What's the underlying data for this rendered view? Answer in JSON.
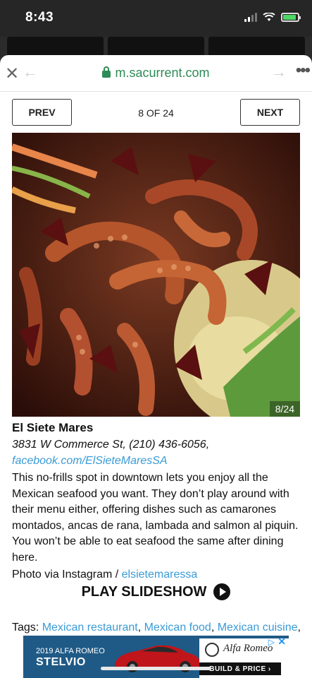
{
  "status": {
    "time": "8:43"
  },
  "browser": {
    "url": "m.sacurrent.com",
    "close_icon": "close-icon",
    "back_icon": "arrow-left-icon",
    "forward_icon": "arrow-right-icon",
    "more_icon": "more-icon"
  },
  "pager": {
    "prev_label": "PREV",
    "counter": "8 OF 24",
    "next_label": "NEXT"
  },
  "photo": {
    "badge": "8/24"
  },
  "article": {
    "title": "El Siete Mares",
    "address": "3831 W Commerce St, (210) 436-6056,",
    "facebook": "facebook.com/ElSieteMaresSA",
    "description": "This no-frills spot in downtown lets you enjoy all the Mexican seafood you want. They don’t play around with their menu either, offering dishes such as camarones montados, ancas de rana, lambada and salmon al piquin. You won’t be able to eat seafood the same after dining here.",
    "credit_prefix": "Photo via Instagram / ",
    "credit_link": "elsietemaressa"
  },
  "slideshow": {
    "label": "PLAY SLIDESHOW"
  },
  "tags": {
    "label": "Tags: ",
    "items": [
      "Mexican restaurant",
      "Mexican food",
      "Mexican cuisine"
    ]
  },
  "ad": {
    "line1": "2019 ALFA ROMEO",
    "line2": "STELVIO",
    "brand": "Alfa Romeo",
    "cta": "BUILD & PRICE ›",
    "brand_color": "#1f5a86"
  }
}
